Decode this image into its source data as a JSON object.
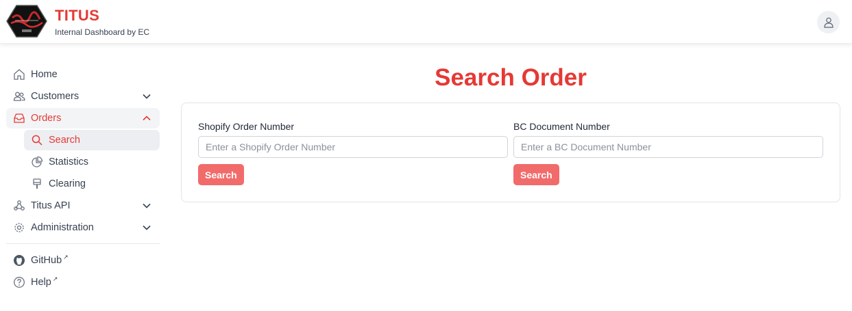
{
  "header": {
    "title": "TITUS",
    "subtitle": "Internal Dashboard by EC",
    "logo_icon": "titus-logo",
    "user_icon": "user-icon"
  },
  "sidebar": {
    "items": [
      {
        "label": "Home",
        "icon": "home-icon"
      },
      {
        "label": "Customers",
        "icon": "users-icon",
        "expandable": true,
        "expanded": false
      },
      {
        "label": "Orders",
        "icon": "inbox-icon",
        "expandable": true,
        "expanded": true,
        "children": [
          {
            "label": "Search",
            "icon": "search-icon",
            "active": true
          },
          {
            "label": "Statistics",
            "icon": "pie-chart-icon"
          },
          {
            "label": "Clearing",
            "icon": "brush-icon"
          }
        ]
      },
      {
        "label": "Titus API",
        "icon": "webhook-icon",
        "expandable": true,
        "expanded": false
      },
      {
        "label": "Administration",
        "icon": "gear-icon",
        "expandable": true,
        "expanded": false
      }
    ],
    "links": [
      {
        "label": "GitHub",
        "icon": "github-icon",
        "external": true
      },
      {
        "label": "Help",
        "icon": "help-icon",
        "external": true
      }
    ]
  },
  "main": {
    "title": "Search Order",
    "shopify": {
      "label": "Shopify Order Number",
      "placeholder": "Enter a Shopify Order Number",
      "value": "",
      "button": "Search"
    },
    "bc": {
      "label": "BC Document Number",
      "placeholder": "Enter a BC Document Number",
      "value": "",
      "button": "Search"
    }
  },
  "colors": {
    "accent": "#e53935",
    "button": "#f26b6b",
    "active_bg": "#eceef2"
  }
}
